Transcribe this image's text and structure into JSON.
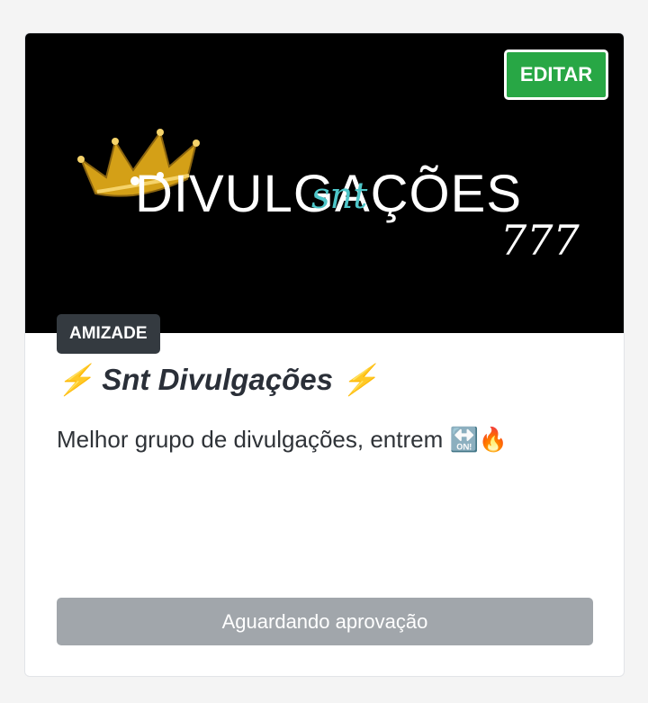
{
  "card": {
    "banner": {
      "logo_word": "DIVULGAÇÕES",
      "logo_script": "snt",
      "logo_number": "777",
      "crown_icon": "crown-icon",
      "colors": {
        "background": "#000000",
        "gold": "#d4a017",
        "script": "#4ec6c9"
      }
    },
    "edit_label": "EDITAR",
    "category": "AMIZADE",
    "title": "⚡ Snt Divulgações ⚡",
    "description": "Melhor grupo de divulgações, entrem 🔛🔥",
    "status_label": "Aguardando aprovação",
    "colors": {
      "edit_button": "#28a745",
      "category_badge": "#343a40",
      "status_button": "#a1a6ab"
    }
  }
}
